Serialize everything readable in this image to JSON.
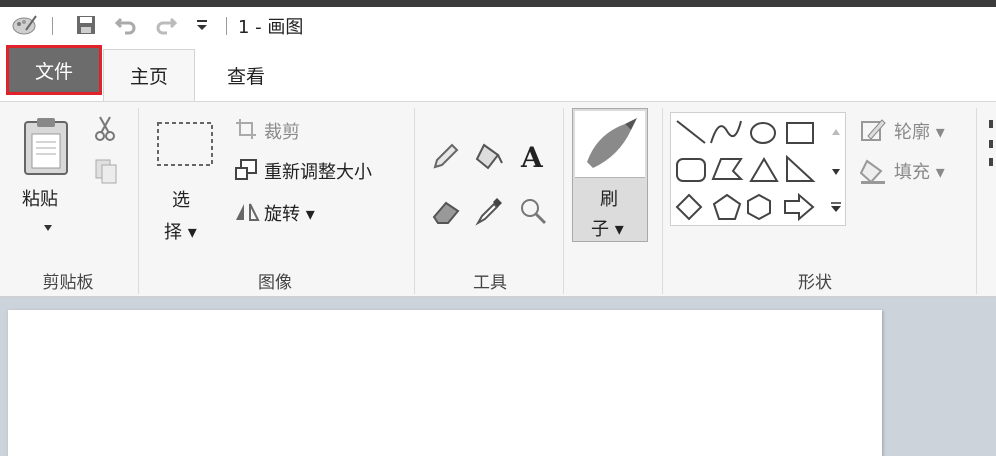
{
  "title": "1 - 画图",
  "tabs": {
    "file": "文件",
    "home": "主页",
    "view": "查看"
  },
  "clipboard": {
    "paste": "粘贴",
    "label": "剪贴板"
  },
  "image": {
    "select_line1": "选",
    "select_line2": "择",
    "crop": "裁剪",
    "resize": "重新调整大小",
    "rotate": "旋转",
    "label": "图像"
  },
  "tools": {
    "label": "工具"
  },
  "brushes": {
    "line1": "刷",
    "line2": "子"
  },
  "shapes": {
    "outline": "轮廓",
    "fill": "填充",
    "label": "形状"
  }
}
